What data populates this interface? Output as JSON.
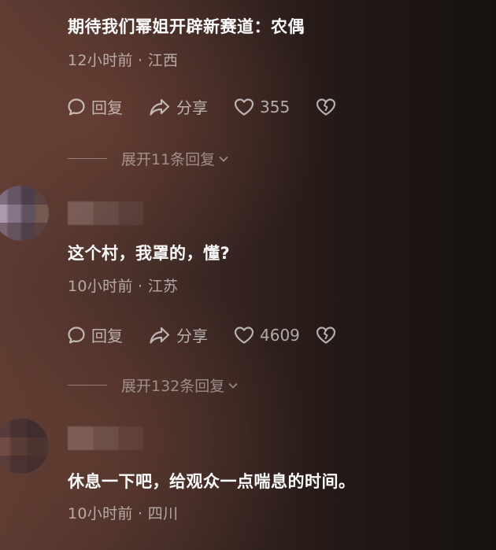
{
  "comments": [
    {
      "text": "期待我们幂姐开辟新赛道：农偶",
      "meta": "12小时前 · 江西",
      "actions": {
        "reply": "回复",
        "share": "分享",
        "likes": "355"
      },
      "expand": "展开11条回复"
    },
    {
      "text": "这个村，我罩的，懂?",
      "meta": "10小时前 · 江苏",
      "actions": {
        "reply": "回复",
        "share": "分享",
        "likes": "4609"
      },
      "expand": "展开132条回复"
    },
    {
      "text": "休息一下吧，给观众一点喘息的时间。",
      "meta": "10小时前 · 四川"
    }
  ],
  "icons": {
    "reply": "chat-bubble-icon",
    "share": "share-arrow-icon",
    "like": "heart-icon",
    "dislike": "broken-heart-icon",
    "expand": "chevron-down-icon"
  }
}
